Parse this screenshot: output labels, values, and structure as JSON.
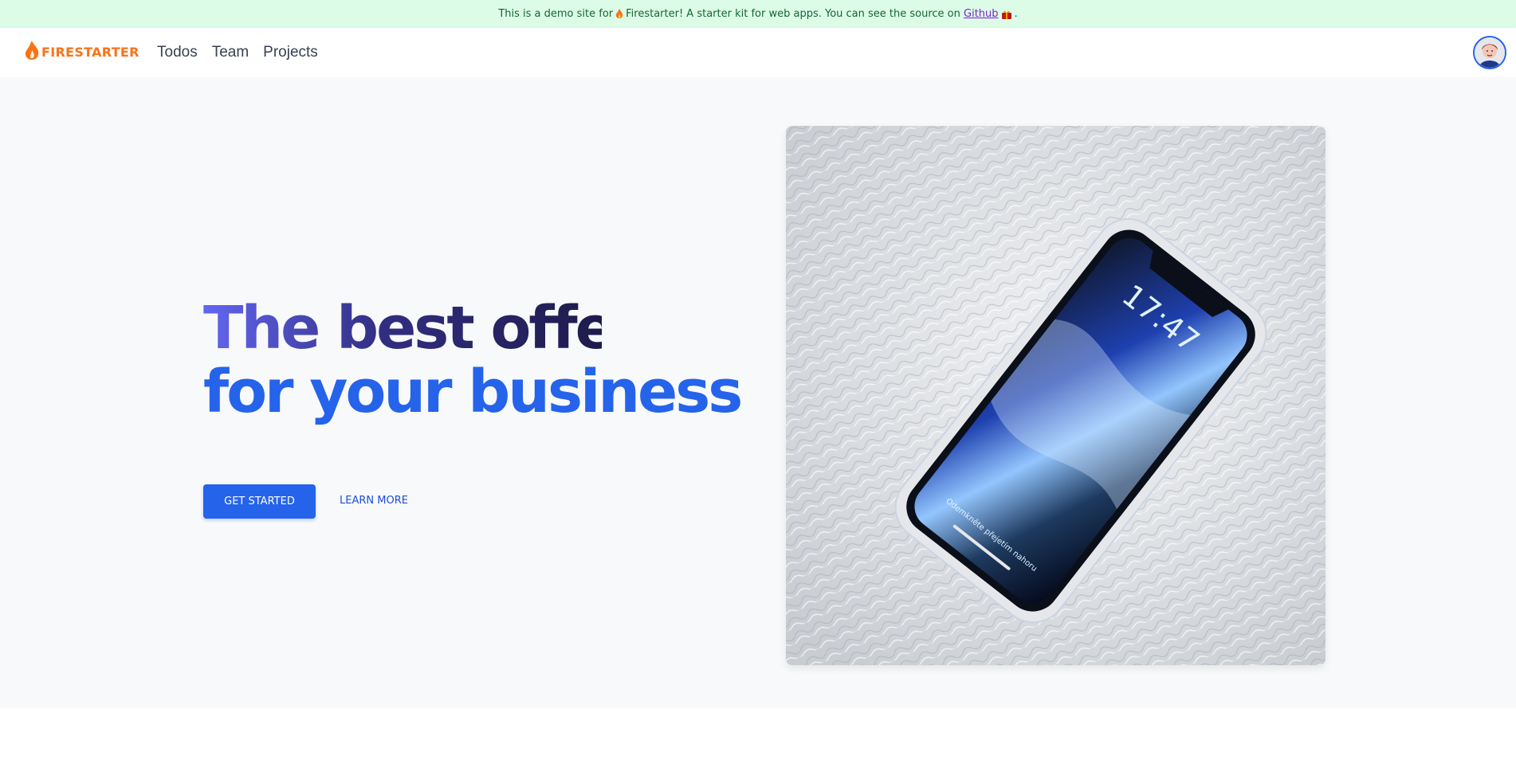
{
  "banner": {
    "text_before": "This is a demo site for",
    "text_middle": "Firestarter! A starter kit for web apps. You can see the source on",
    "link_label": "Github",
    "text_after": "."
  },
  "nav": {
    "logo_text": "FIRESTARTER",
    "links": [
      {
        "label": "Todos"
      },
      {
        "label": "Team"
      },
      {
        "label": "Projects"
      }
    ]
  },
  "hero": {
    "headline_line1": "The best offer",
    "headline_line2": "for your business",
    "primary_cta": "GET STARTED",
    "secondary_cta": "LEARN MORE",
    "phone_time": "17:47",
    "phone_hint": "Odemkněte přejetím nahoru"
  },
  "colors": {
    "brand": "#f97316",
    "primary": "#2563eb",
    "banner_bg": "#dcfce7",
    "banner_text": "#166534",
    "hero_bg": "#f8f9fa"
  }
}
